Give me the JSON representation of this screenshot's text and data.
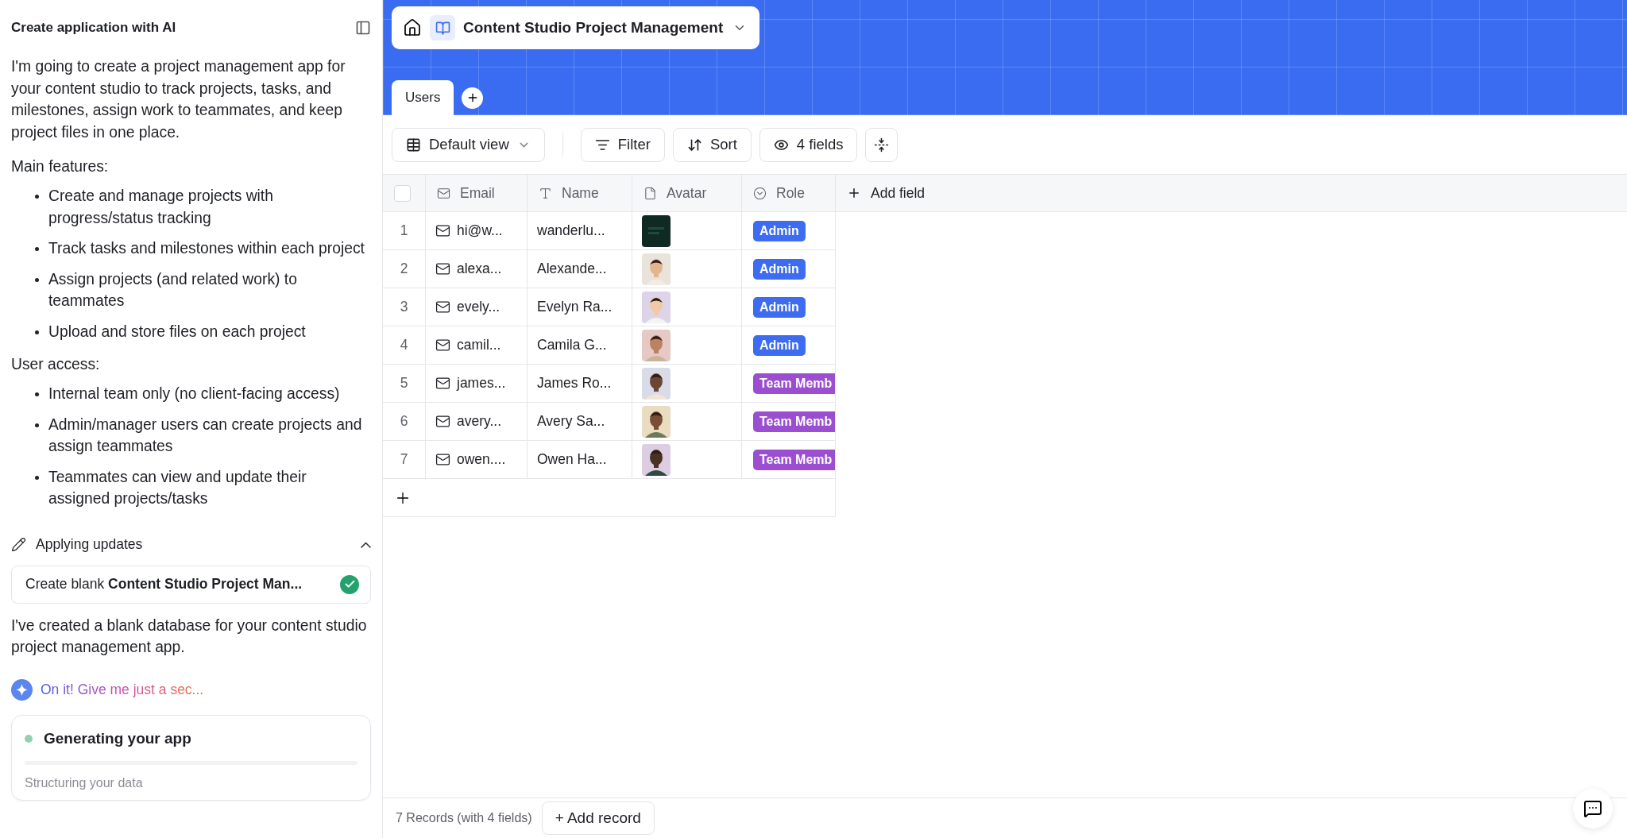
{
  "assistant": {
    "title": "Create application with AI",
    "intro": "I'm going to create a project management app for your content studio to track projects, tasks, and milestones, assign work to teammates, and keep project files in one place.",
    "sections": [
      {
        "heading": "Main features:",
        "items": [
          "Create and manage projects with progress/status tracking",
          "Track tasks and milestones within each project",
          "Assign projects (and related work) to teammates",
          "Upload and store files on each project"
        ]
      },
      {
        "heading": "User access:",
        "items": [
          "Internal team only (no client-facing access)",
          "Admin/manager users can create projects and assign teammates",
          "Teammates can view and update their assigned projects/tasks"
        ]
      }
    ],
    "updates": {
      "label": "Applying updates",
      "expanded": true,
      "steps": [
        {
          "text": "Create blank **Content Studio Project Man...**",
          "done": true
        }
      ]
    },
    "reply": "I've created a blank database for your content studio project management app.",
    "thinking": "On it! Give me just a sec...",
    "progress": {
      "title": "Generating your app",
      "status": "Structuring your data"
    }
  },
  "app": {
    "title": "Content Studio Project Management",
    "tabs": [
      {
        "label": "Users",
        "selected": true
      }
    ],
    "toolbar": {
      "view": "Default view",
      "buttons": [
        {
          "kind": "filter",
          "label": "Filter"
        },
        {
          "kind": "sort",
          "label": "Sort"
        },
        {
          "kind": "fields",
          "label": "4 fields"
        },
        {
          "kind": "height"
        }
      ]
    },
    "table": {
      "select_all_checked": false,
      "columns": [
        {
          "kind": "email",
          "label": "Email"
        },
        {
          "kind": "text",
          "label": "Name"
        },
        {
          "kind": "file",
          "label": "Avatar"
        },
        {
          "kind": "select",
          "label": "Role"
        }
      ],
      "add_field": "Add field",
      "rows": [
        {
          "number": "1",
          "email": "hi@w...",
          "name": "wanderlu...",
          "role": {
            "label": "Admin",
            "color": "#3e6cf0"
          }
        },
        {
          "number": "2",
          "email": "alexa...",
          "name": "Alexande...",
          "role": {
            "label": "Admin",
            "color": "#3e6cf0"
          }
        },
        {
          "number": "3",
          "email": "evely...",
          "name": "Evelyn Ra...",
          "role": {
            "label": "Admin",
            "color": "#3e6cf0"
          }
        },
        {
          "number": "4",
          "email": "camil...",
          "name": "Camila G...",
          "role": {
            "label": "Admin",
            "color": "#3e6cf0"
          }
        },
        {
          "number": "5",
          "email": "james...",
          "name": "James Ro...",
          "role": {
            "label": "Team Memb",
            "color": "#9b4fd0"
          }
        },
        {
          "number": "6",
          "email": "avery...",
          "name": "Avery Sa...",
          "role": {
            "label": "Team Memb",
            "color": "#9b4fd0"
          }
        },
        {
          "number": "7",
          "email": "owen....",
          "name": "Owen Ha...",
          "role": {
            "label": "Team Memb",
            "color": "#9b4fd0"
          }
        }
      ]
    },
    "footer": {
      "summary": "7 Records (with 4 fields)",
      "add_record": "+ Add record"
    }
  }
}
